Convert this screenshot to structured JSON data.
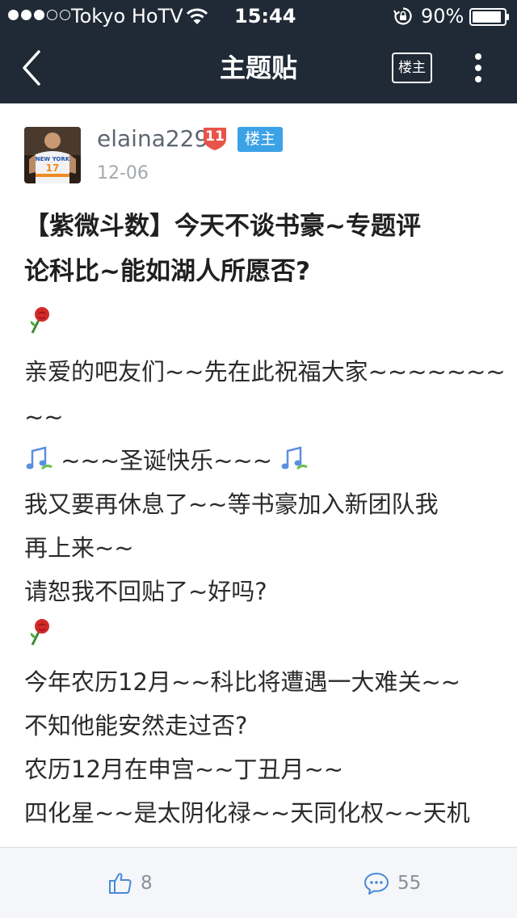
{
  "status_bar": {
    "carrier": "Tokyo HoTV",
    "time": "15:44",
    "battery": "90%",
    "signal_bars_filled": 3,
    "signal_bars_total": 5
  },
  "nav": {
    "title": "主题贴",
    "op_only_label": "楼主"
  },
  "author": {
    "name": "elaina229",
    "level": "11",
    "badge": "楼主",
    "date": "12-06",
    "jersey_text": "NEW YORK",
    "jersey_number": "17"
  },
  "post": {
    "title_line1": "【紫微斗数】今天不谈书豪~专题评",
    "title_line2": "论科比~能如湖人所愿否?",
    "line1": "亲爱的吧友们~~先在此祝福大家~~~~~~~",
    "line2": "~~",
    "line3": "~~~圣诞快乐~~~",
    "line4": "我又要再休息了~~等书豪加入新团队我",
    "line5": "再上来~~",
    "line6": "请恕我不回贴了~好吗?",
    "line7": "今年农历12月~~科比将遭遇一大难关~~",
    "line8": "不知他能安然走过否?",
    "line9": "农历12月在申宫~~丁丑月~~",
    "line10": "四化星~~是太阴化禄~~天同化权~~天机"
  },
  "toolbar": {
    "likes": "8",
    "comments": "55"
  },
  "icons": {
    "back": "chevron-left-icon",
    "more": "more-vertical-icon",
    "like": "thumbs-up-icon",
    "comment": "comment-bubble-icon",
    "rose": "rose-emoji-icon",
    "music": "musical-notes-emoji-icon"
  },
  "colors": {
    "header_bg": "#202a36",
    "op_badge": "#3ca2e6",
    "level_badge": "#e8544a",
    "accent_icon": "#4a8ad8"
  }
}
